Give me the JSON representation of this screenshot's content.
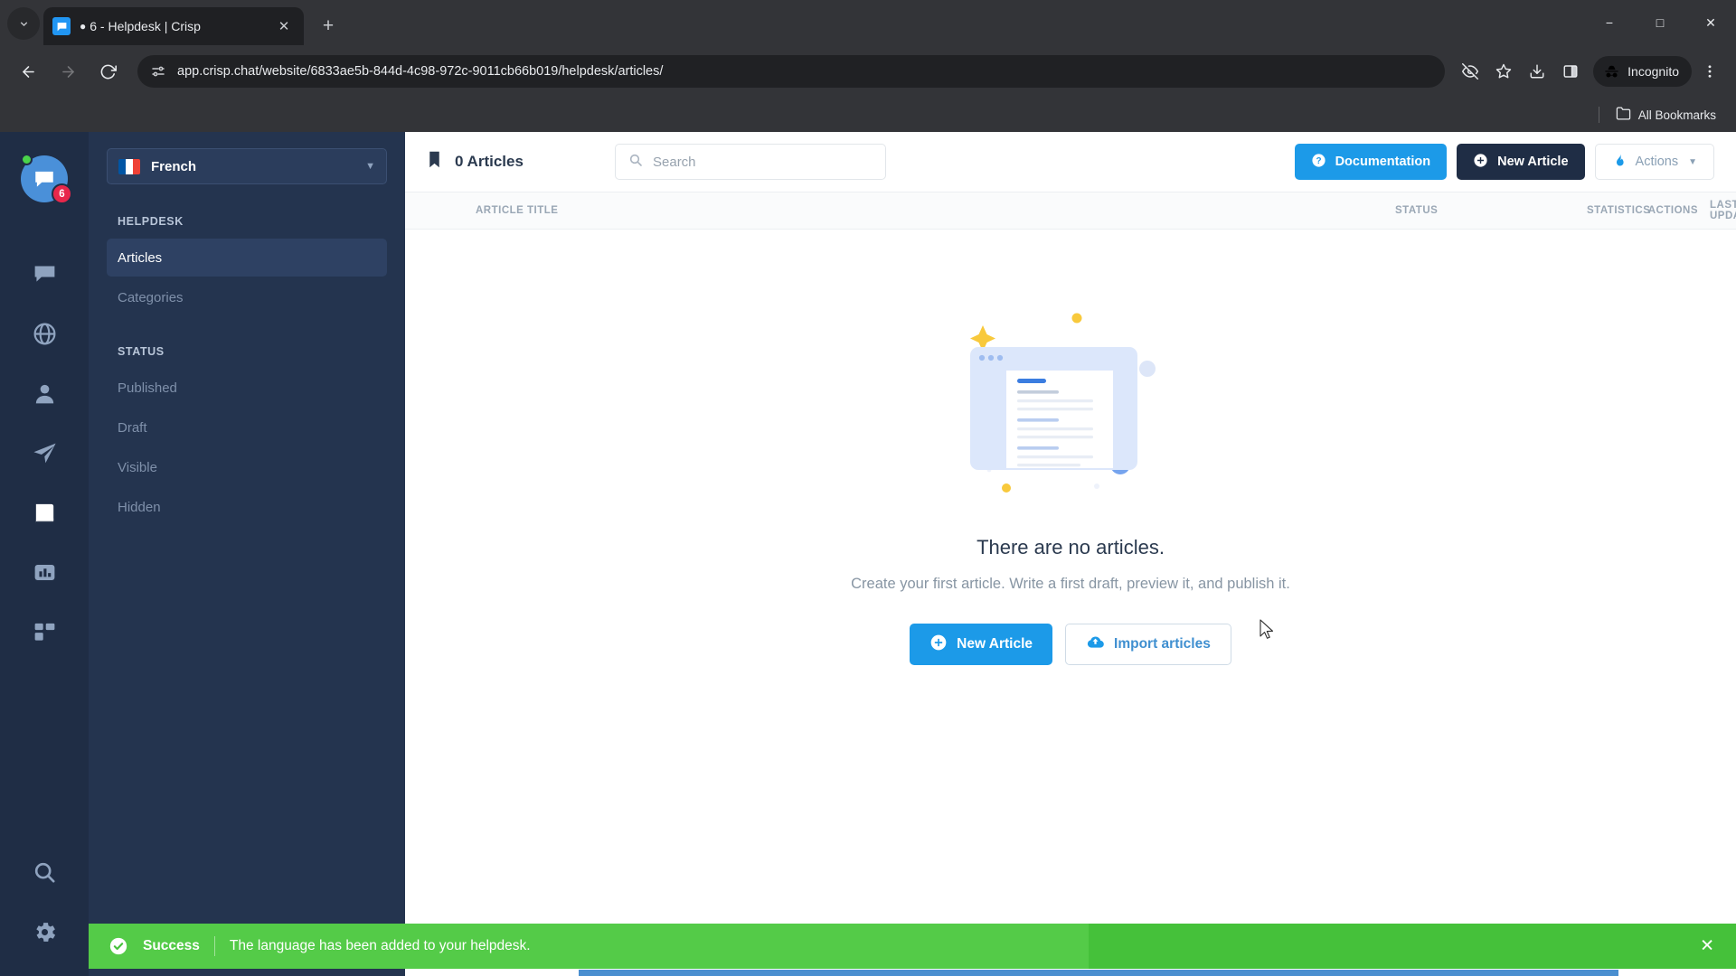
{
  "browser": {
    "tab": {
      "title": "6 - Helpdesk | Crisp",
      "glyph": "●",
      "favicon_icon": "crisp-chat-icon",
      "close_icon": "close-icon"
    },
    "new_tab_label": "+",
    "tabstrip_chevron_icon": "chevron-down-icon",
    "window_controls": {
      "minimize": "−",
      "maximize": "□",
      "close": "✕"
    },
    "nav": {
      "back_icon": "back-arrow-icon",
      "forward_icon": "forward-arrow-icon",
      "reload_icon": "reload-icon"
    },
    "omnibox": {
      "url": "app.crisp.chat/website/6833ae5b-844d-4c98-972c-9011cb66b019/helpdesk/articles/",
      "site_info_icon": "site-settings-icon"
    },
    "toolbar_icons": [
      "eye-off-icon",
      "bookmark-star-icon",
      "download-icon",
      "side-panel-icon",
      "three-dot-menu-icon"
    ],
    "incognito_label": "Incognito",
    "bookmarks": {
      "all_bookmarks_label": "All Bookmarks",
      "folder_icon": "folder-icon"
    }
  },
  "rail": {
    "avatar": {
      "badge_count": "6",
      "status": "online",
      "icon": "chat-bubble-icon"
    },
    "items": [
      {
        "name": "inbox",
        "icon": "chat-bubble-icon",
        "active": false
      },
      {
        "name": "website",
        "icon": "globe-icon",
        "active": false
      },
      {
        "name": "contacts",
        "icon": "person-icon",
        "active": false
      },
      {
        "name": "campaigns",
        "icon": "paper-plane-icon",
        "active": false
      },
      {
        "name": "helpdesk",
        "icon": "book-icon",
        "active": true
      },
      {
        "name": "analytics",
        "icon": "bar-chart-icon",
        "active": false
      },
      {
        "name": "plugins",
        "icon": "grid-icon",
        "active": false
      }
    ],
    "bottom": [
      {
        "name": "search",
        "icon": "magnifier-icon"
      },
      {
        "name": "settings",
        "icon": "gear-icon"
      }
    ]
  },
  "sidebar": {
    "language": {
      "label": "French",
      "flag": "fr",
      "caret_icon": "chevron-down-icon"
    },
    "sections": [
      {
        "title": "HELPDESK",
        "items": [
          {
            "label": "Articles",
            "active": true
          },
          {
            "label": "Categories",
            "active": false
          }
        ]
      },
      {
        "title": "STATUS",
        "items": [
          {
            "label": "Published",
            "active": false
          },
          {
            "label": "Draft",
            "active": false
          },
          {
            "label": "Visible",
            "active": false
          },
          {
            "label": "Hidden",
            "active": false
          }
        ]
      }
    ]
  },
  "main": {
    "header": {
      "count_label": "0 Articles",
      "count_icon": "bookmark-icon",
      "search": {
        "placeholder": "Search",
        "value": "",
        "icon": "search-icon"
      },
      "buttons": {
        "documentation": {
          "label": "Documentation",
          "icon": "question-circle-icon",
          "color": "#1c9ae8"
        },
        "new_article": {
          "label": "New Article",
          "icon": "plus-circle-icon",
          "color": "#1f2d45"
        },
        "actions": {
          "label": "Actions",
          "icon": "flame-icon",
          "caret_icon": "chevron-down-icon"
        }
      }
    },
    "table": {
      "columns": [
        "ARTICLE TITLE",
        "STATUS",
        "STATISTICS",
        "LAST UPDATE",
        "ACTIONS"
      ]
    },
    "empty_state": {
      "illustration": "empty-articles-illustration",
      "title": "There are no articles.",
      "subtitle": "Create your first article. Write a first draft, preview it, and publish it.",
      "primary_button": {
        "label": "New Article",
        "icon": "plus-circle-icon"
      },
      "secondary_button": {
        "label": "Import articles",
        "icon": "cloud-upload-icon"
      }
    }
  },
  "toast": {
    "status_word": "Success",
    "message": "The language has been added to your helpdesk.",
    "icon": "check-circle-icon",
    "close_icon": "close-icon",
    "color": "#45c13a"
  }
}
